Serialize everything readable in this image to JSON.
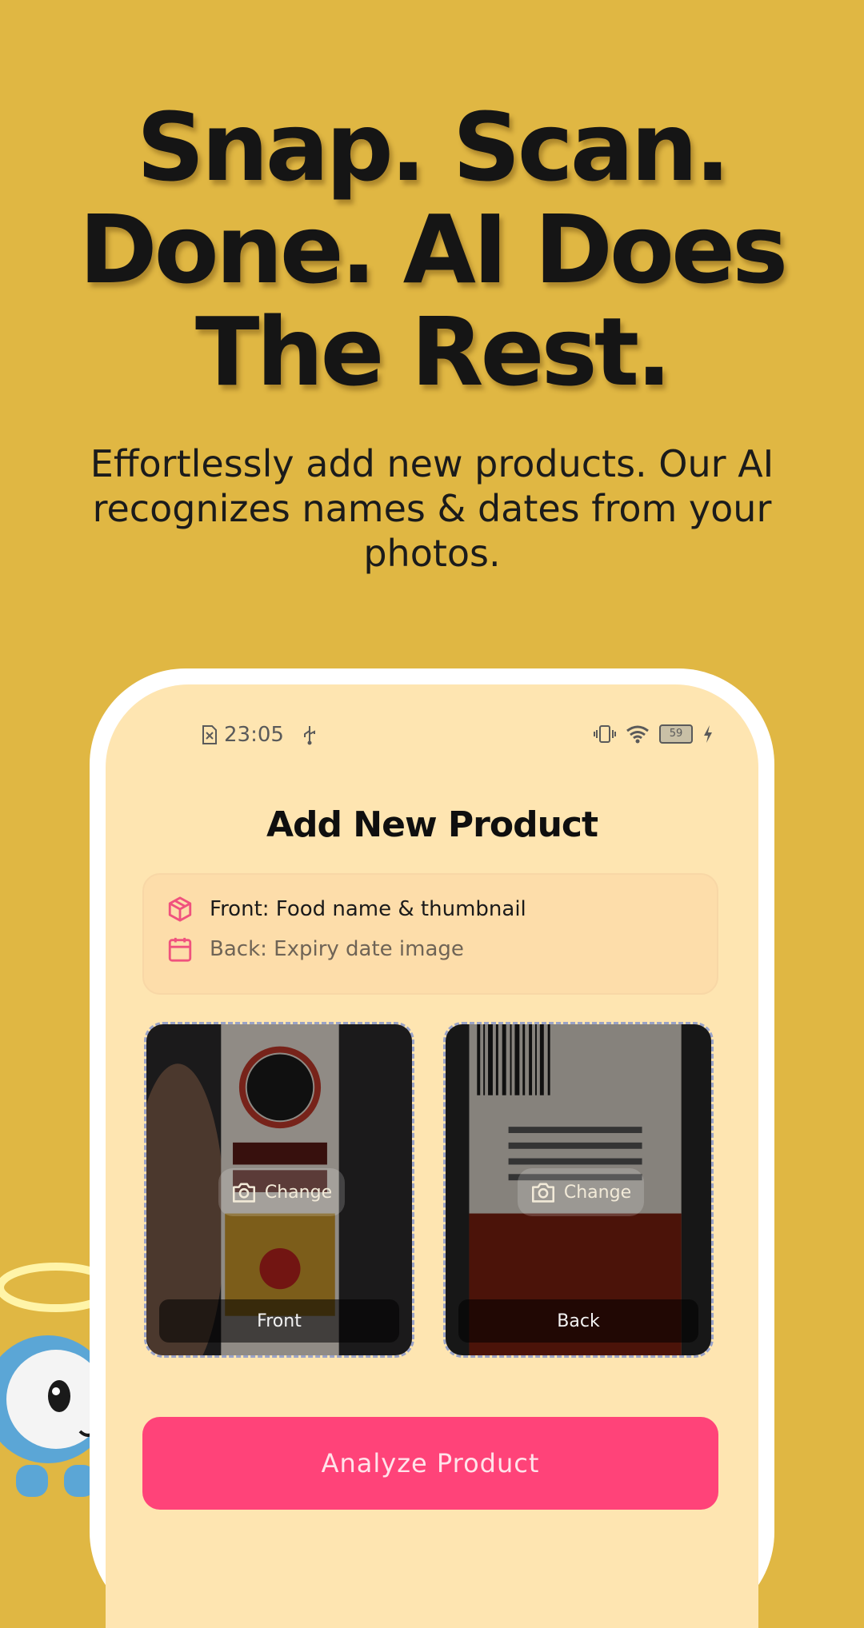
{
  "hero": {
    "headline": "Snap. Scan. Done. AI Does The Rest.",
    "subtitle": "Effortlessly add new products. Our AI recognizes names & dates from your photos."
  },
  "status_bar": {
    "time": "23:05",
    "battery": "59",
    "icons": [
      "sim-error-icon",
      "usb-icon",
      "vibrate-icon",
      "wifi-icon",
      "battery-icon",
      "charging-icon"
    ]
  },
  "screen": {
    "title": "Add New Product",
    "info": {
      "front_text": "Front: Food name & thumbnail",
      "back_text": "Back: Expiry date image",
      "front_icon": "package-icon",
      "back_icon": "calendar-icon"
    },
    "photos": [
      {
        "label": "Front",
        "change_label": "Change"
      },
      {
        "label": "Back",
        "change_label": "Change"
      }
    ],
    "analyze_label": "Analyze Product"
  },
  "colors": {
    "background": "#E0B743",
    "screen": "#FEE5B1",
    "accent": "#FF4379",
    "icon_accent": "#F0527E"
  }
}
